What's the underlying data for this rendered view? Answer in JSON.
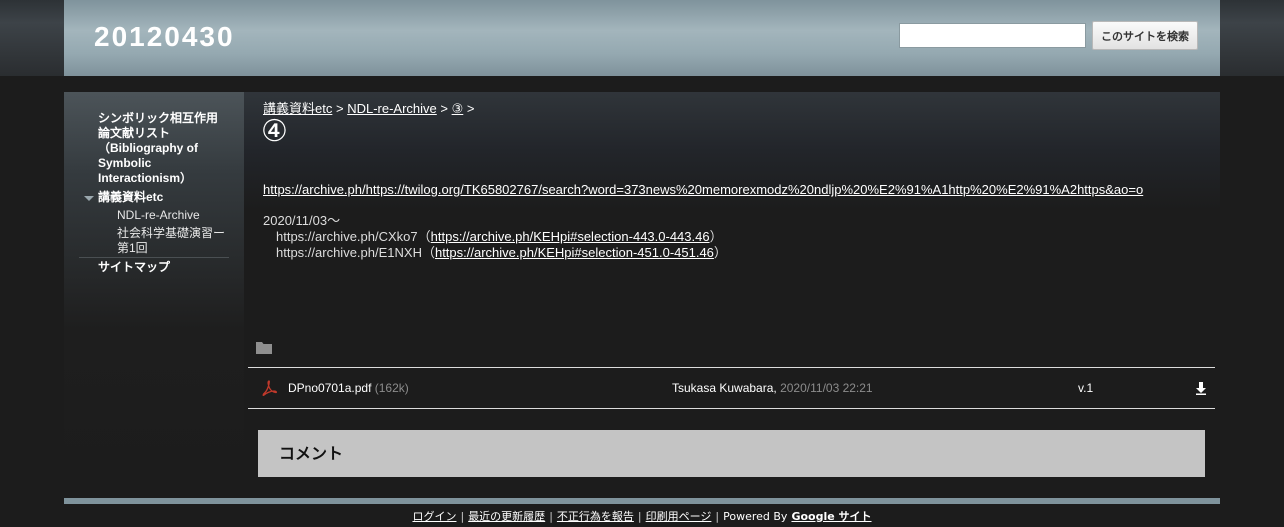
{
  "header": {
    "site_title": "20120430",
    "search_button_label": "このサイトを検索"
  },
  "sidebar": {
    "items": [
      {
        "label": "シンボリック相互作用論文献リスト（Bibliography of Symbolic Interactionism）"
      },
      {
        "label": "講義資料etc",
        "expanded": true
      },
      {
        "label": "NDL-re-Archive"
      },
      {
        "label": "社会科学基礎演習ー第1回"
      },
      {
        "label": "サイトマップ"
      }
    ],
    "item0_lines": [
      "シンボリック相互作用",
      "論文献リスト",
      "（Bibliography of",
      "Symbolic",
      "Interactionism）"
    ],
    "item3_lines": [
      "社会科学基礎演習ー",
      "第1回"
    ]
  },
  "breadcrumb": {
    "items": [
      "講義資料etc",
      "NDL-re-Archive",
      "③"
    ],
    "separator": ">"
  },
  "page": {
    "title": "④",
    "archive_link": "https://archive.ph/https://twilog.org/TK65802767/search?word=373news%20memorexmodz%20ndljp%20%E2%91%A1http%20%E2%91%A2https&ao=o",
    "date_line": "2020/11/03～",
    "lines": [
      {
        "prefix": "https://archive.ph/CXko7（",
        "link": "https://archive.ph/KEHpi#selection-443.0-443.46",
        "suffix": "）"
      },
      {
        "prefix": "https://archive.ph/E1NXH（",
        "link": "https://archive.ph/KEHpi#selection-451.0-451.46",
        "suffix": "）"
      }
    ]
  },
  "attachment": {
    "filename": "DPno0701a.pdf",
    "size": "(162k)",
    "author": "Tsukasa Kuwabara,",
    "date": "2020/11/03 22:21",
    "version": "v.1"
  },
  "comments": {
    "title": "コメント"
  },
  "footer": {
    "links": [
      "ログイン",
      "最近の更新履歴",
      "不正行為を報告",
      "印刷用ページ"
    ],
    "powered_by": "Powered By",
    "google_sites": "Google サイト"
  },
  "colors": {
    "header": "#a3b5bc",
    "background": "#1c1c1c",
    "comment_box": "#c4c4c4",
    "pdf_icon": "#c0392b"
  },
  "icons": [
    "chevron-down-icon",
    "folder-icon",
    "pdf-icon",
    "download-icon"
  ]
}
